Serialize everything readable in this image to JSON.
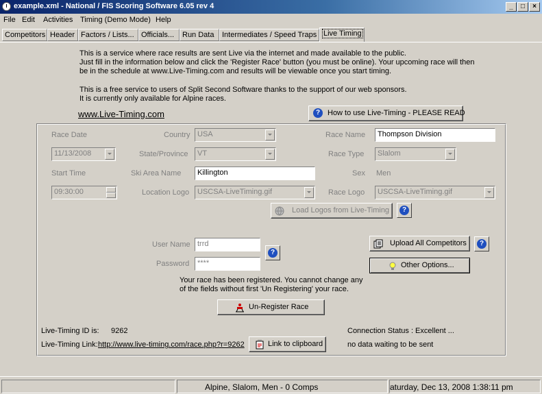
{
  "window": {
    "title": "example.xml - National / FIS Scoring Software 6.05 rev 4",
    "min_label": "_",
    "max_label": "□",
    "close_label": "×"
  },
  "menu": [
    "File",
    "Edit",
    "Activities",
    "Timing (Demo Mode)",
    "Help"
  ],
  "tabs": [
    "Competitors",
    "Header",
    "Factors / Lists...",
    "Officials...",
    "Run Data",
    "Intermediates / Speed Traps",
    "Live Timing"
  ],
  "active_tab": "Live Timing",
  "intro": {
    "line1": "This is a service where race results are sent Live via the internet and made available to the public.",
    "line2": "Just fill in the information below and click the 'Register Race' button (you must be online). Your upcoming race will then",
    "line3": "be in the schedule at www.Live-Timing.com and results will be viewable once you start timing.",
    "line4": "This is a free service to users of Split Second Software thanks to the support of our web sponsors.",
    "line5": "It is currently only available for Alpine races.",
    "site_link": "www.Live-Timing.com",
    "how_to_button": "How to use Live-Timing - PLEASE READ"
  },
  "form": {
    "race_date_label": "Race Date",
    "race_date": "11/13/2008",
    "start_time_label": "Start Time",
    "start_time": "09:30:00",
    "country_label": "Country",
    "country": "USA",
    "state_label": "State/Province",
    "state": "VT",
    "ski_area_label": "Ski Area Name",
    "ski_area": "Killington",
    "location_logo_label": "Location Logo",
    "location_logo": "USCSA-LiveTiming.gif",
    "race_name_label": "Race Name",
    "race_name": "Thompson Division",
    "race_type_label": "Race Type",
    "race_type": "Slalom",
    "sex_label": "Sex",
    "sex": "Men",
    "race_logo_label": "Race Logo",
    "race_logo": "USCSA-LiveTiming.gif",
    "load_logos_button": "Load Logos from Live-Timing",
    "user_name_label": "User Name",
    "user_name": "trrd",
    "password_label": "Password",
    "password": "****",
    "upload_button": "Upload All Competitors",
    "other_options_button": "Other Options...",
    "registered_msg1": "Your race has been registered. You cannot change any",
    "registered_msg2": "of the fields without first 'Un Registering' your race.",
    "unregister_button": "Un-Register Race",
    "id_label": "Live-Timing ID is:",
    "id_value": "9262",
    "link_label": "Live-Timing Link:",
    "link_value": "http://www.live-timing.com/race.php?r=9262",
    "clipboard_button": "Link to clipboard",
    "connection_status": "Connection Status : Excellent ...",
    "queue_status": "no data waiting to be sent"
  },
  "help_glyph": "?",
  "statusbar": {
    "race_info": "Alpine, Slalom, Men - 0 Comps",
    "datetime": "aturday, Dec 13, 2008  1:38:11 pm"
  }
}
